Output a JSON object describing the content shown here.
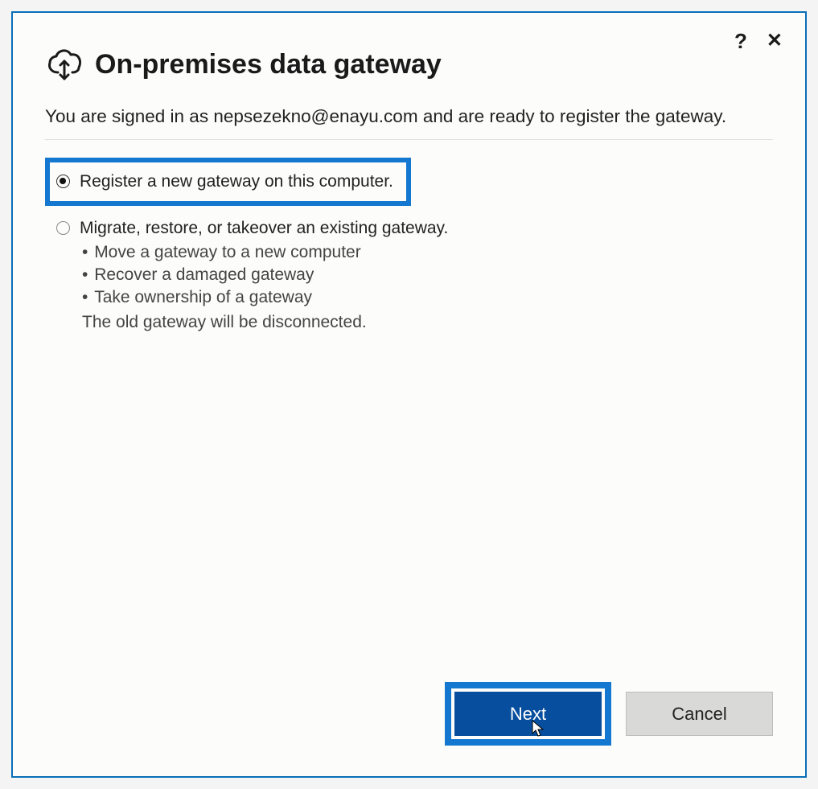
{
  "header": {
    "title": "On-premises data gateway",
    "subtitle": "You are signed in as nepsezekno@enayu.com and are ready to register the gateway."
  },
  "options": {
    "register": {
      "label": "Register a new gateway on this computer.",
      "selected": true
    },
    "migrate": {
      "label": "Migrate, restore, or takeover an existing gateway.",
      "selected": false,
      "bullets": [
        "Move a gateway to a new computer",
        "Recover a damaged gateway",
        "Take ownership of a gateway"
      ],
      "note": "The old gateway will be disconnected."
    }
  },
  "buttons": {
    "next": "Next",
    "cancel": "Cancel"
  },
  "controls": {
    "help": "?",
    "close": "✕"
  }
}
